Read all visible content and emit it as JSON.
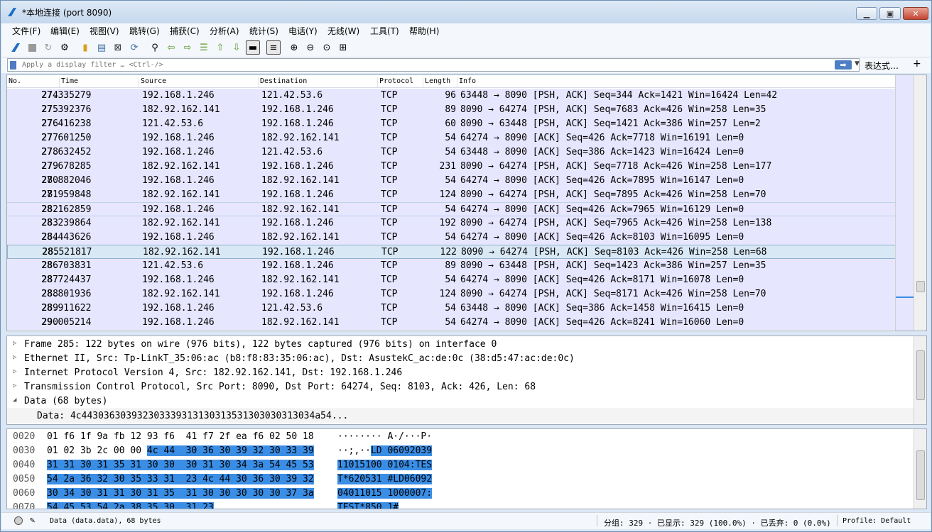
{
  "window": {
    "title": "*本地连接 (port 8090)"
  },
  "menu": [
    "文件(F)",
    "编辑(E)",
    "视图(V)",
    "跳转(G)",
    "捕获(C)",
    "分析(A)",
    "统计(S)",
    "电话(Y)",
    "无线(W)",
    "工具(T)",
    "帮助(H)"
  ],
  "filter": {
    "placeholder": "Apply a display filter … <Ctrl-/>",
    "expression_label": "表达式…",
    "plus_label": "+"
  },
  "columns": [
    "No.",
    "Time",
    "Source",
    "Destination",
    "Protocol",
    "Length",
    "Info"
  ],
  "packets": [
    {
      "no": "274",
      "time": "27.335279",
      "src": "192.168.1.246",
      "dst": "121.42.53.6",
      "proto": "TCP",
      "len": "96",
      "info": "63448 → 8090 [PSH, ACK] Seq=344 Ack=1421 Win=16424 Len=42"
    },
    {
      "no": "275",
      "time": "27.392376",
      "src": "182.92.162.141",
      "dst": "192.168.1.246",
      "proto": "TCP",
      "len": "89",
      "info": "8090 → 64274 [PSH, ACK] Seq=7683 Ack=426 Win=258 Len=35"
    },
    {
      "no": "276",
      "time": "27.416238",
      "src": "121.42.53.6",
      "dst": "192.168.1.246",
      "proto": "TCP",
      "len": "60",
      "info": "8090 → 63448 [PSH, ACK] Seq=1421 Ack=386 Win=257 Len=2"
    },
    {
      "no": "277",
      "time": "27.601250",
      "src": "192.168.1.246",
      "dst": "182.92.162.141",
      "proto": "TCP",
      "len": "54",
      "info": "64274 → 8090 [ACK] Seq=426 Ack=7718 Win=16191 Len=0"
    },
    {
      "no": "278",
      "time": "27.632452",
      "src": "192.168.1.246",
      "dst": "121.42.53.6",
      "proto": "TCP",
      "len": "54",
      "info": "63448 → 8090 [ACK] Seq=386 Ack=1423 Win=16424 Len=0"
    },
    {
      "no": "279",
      "time": "27.678285",
      "src": "182.92.162.141",
      "dst": "192.168.1.246",
      "proto": "TCP",
      "len": "231",
      "info": "8090 → 64274 [PSH, ACK] Seq=7718 Ack=426 Win=258 Len=177"
    },
    {
      "no": "280",
      "time": "27.882046",
      "src": "192.168.1.246",
      "dst": "182.92.162.141",
      "proto": "TCP",
      "len": "54",
      "info": "64274 → 8090 [ACK] Seq=426 Ack=7895 Win=16147 Len=0"
    },
    {
      "no": "281",
      "time": "27.959848",
      "src": "182.92.162.141",
      "dst": "192.168.1.246",
      "proto": "TCP",
      "len": "124",
      "info": "8090 → 64274 [PSH, ACK] Seq=7895 Ack=426 Win=258 Len=70"
    },
    {
      "no": "282",
      "time": "28.162859",
      "src": "192.168.1.246",
      "dst": "182.92.162.141",
      "proto": "TCP",
      "len": "54",
      "info": "64274 → 8090 [ACK] Seq=426 Ack=7965 Win=16129 Len=0"
    },
    {
      "no": "283",
      "time": "28.239864",
      "src": "182.92.162.141",
      "dst": "192.168.1.246",
      "proto": "TCP",
      "len": "192",
      "info": "8090 → 64274 [PSH, ACK] Seq=7965 Ack=426 Win=258 Len=138"
    },
    {
      "no": "284",
      "time": "28.443626",
      "src": "192.168.1.246",
      "dst": "182.92.162.141",
      "proto": "TCP",
      "len": "54",
      "info": "64274 → 8090 [ACK] Seq=426 Ack=8103 Win=16095 Len=0"
    },
    {
      "no": "285",
      "time": "28.521817",
      "src": "182.92.162.141",
      "dst": "192.168.1.246",
      "proto": "TCP",
      "len": "122",
      "info": "8090 → 64274 [PSH, ACK] Seq=8103 Ack=426 Win=258 Len=68"
    },
    {
      "no": "286",
      "time": "28.703831",
      "src": "121.42.53.6",
      "dst": "192.168.1.246",
      "proto": "TCP",
      "len": "89",
      "info": "8090 → 63448 [PSH, ACK] Seq=1423 Ack=386 Win=257 Len=35"
    },
    {
      "no": "287",
      "time": "28.724437",
      "src": "192.168.1.246",
      "dst": "182.92.162.141",
      "proto": "TCP",
      "len": "54",
      "info": "64274 → 8090 [ACK] Seq=426 Ack=8171 Win=16078 Len=0"
    },
    {
      "no": "288",
      "time": "28.801936",
      "src": "182.92.162.141",
      "dst": "192.168.1.246",
      "proto": "TCP",
      "len": "124",
      "info": "8090 → 64274 [PSH, ACK] Seq=8171 Ack=426 Win=258 Len=70"
    },
    {
      "no": "289",
      "time": "28.911622",
      "src": "192.168.1.246",
      "dst": "121.42.53.6",
      "proto": "TCP",
      "len": "54",
      "info": "63448 → 8090 [ACK] Seq=386 Ack=1458 Win=16415 Len=0"
    },
    {
      "no": "290",
      "time": "29.005214",
      "src": "192.168.1.246",
      "dst": "182.92.162.141",
      "proto": "TCP",
      "len": "54",
      "info": "64274 → 8090 [ACK] Seq=426 Ack=8241 Win=16060 Len=0"
    }
  ],
  "details": [
    {
      "arrow": "▷",
      "text": "Frame 285: 122 bytes on wire (976 bits), 122 bytes captured (976 bits) on interface 0"
    },
    {
      "arrow": "▷",
      "text": "Ethernet II, Src: Tp-LinkT_35:06:ac (b8:f8:83:35:06:ac), Dst: AsustekC_ac:de:0c (38:d5:47:ac:de:0c)"
    },
    {
      "arrow": "▷",
      "text": "Internet Protocol Version 4, Src: 182.92.162.141, Dst: 192.168.1.246"
    },
    {
      "arrow": "▷",
      "text": "Transmission Control Protocol, Src Port: 8090, Dst Port: 64274, Seq: 8103, Ack: 426, Len: 68"
    },
    {
      "arrow": "◢",
      "text": "Data (68 bytes)"
    },
    {
      "arrow": "",
      "text": "Data: 4c443036303932303339313130313531303030313034a54..."
    }
  ],
  "bytes": [
    {
      "offset": "0020",
      "hex_plain": "01 f6 1f 9a fb 12 93 f6  41 f7 2f ea f6 02 50 18",
      "hex_sel": "",
      "hex_tail": "",
      "ascii_plain": "········ A·/···P·",
      "ascii_sel": ""
    },
    {
      "offset": "0030",
      "hex_plain": "01 02 3b 2c 00 00 ",
      "hex_sel": "4c 44  30 36 30 39 32 30 33 39",
      "hex_tail": "",
      "ascii_plain": "··;,··",
      "ascii_sel": "LD 06092039"
    },
    {
      "offset": "0040",
      "hex_plain": "",
      "hex_sel": "31 31 30 31 35 31 30 30  30 31 30 34 3a 54 45 53",
      "hex_tail": "",
      "ascii_plain": "",
      "ascii_sel": "11015100 0104:TES"
    },
    {
      "offset": "0050",
      "hex_plain": "",
      "hex_sel": "54 2a 36 32 30 35 33 31  23 4c 44 30 36 30 39 32",
      "hex_tail": "",
      "ascii_plain": "",
      "ascii_sel": "T*620531 #LD06092"
    },
    {
      "offset": "0060",
      "hex_plain": "",
      "hex_sel": "30 34 30 31 31 30 31 35  31 30 30 30 30 30 37 3a",
      "hex_tail": "",
      "ascii_plain": "",
      "ascii_sel": "04011015 1000007:"
    },
    {
      "offset": "0070",
      "hex_plain": "",
      "hex_sel": "54 45 53 54 2a 38 35 30  31 23",
      "hex_tail": "",
      "ascii_plain": "",
      "ascii_sel": "TEST*850 1#"
    }
  ],
  "status": {
    "left": "Data (data.data), 68 bytes",
    "counts": "分组: 329 · 已显示: 329 (100.0%) · 已丢弃: 0 (0.0%)",
    "profile": "Profile: Default"
  },
  "colors": {
    "row_bg": "#e7e6ff",
    "selection": "#3a8ee6"
  }
}
